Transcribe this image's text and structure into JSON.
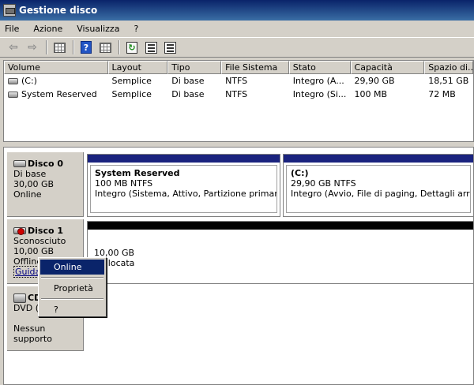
{
  "window": {
    "title": "Gestione disco"
  },
  "menu": [
    "File",
    "Azione",
    "Visualizza",
    "?"
  ],
  "toolbar": {
    "icons": [
      "back-arrow-icon",
      "forward-arrow-icon",
      "console-tree-icon",
      "help-icon",
      "grid-view-icon",
      "refresh-icon",
      "properties-icon",
      "settings-icon"
    ],
    "help_glyph": "?"
  },
  "volume_list": {
    "columns": [
      "Volume",
      "Layout",
      "Tipo",
      "File Sistema",
      "Stato",
      "Capacità",
      "Spazio di..."
    ],
    "rows": [
      [
        "(C:)",
        "Semplice",
        "Di base",
        "NTFS",
        "Integro (A...",
        "29,90 GB",
        "18,51 GB"
      ],
      [
        "System Reserved",
        "Semplice",
        "Di base",
        "NTFS",
        "Integro (Si...",
        "100 MB",
        "72 MB"
      ]
    ]
  },
  "disks": [
    {
      "name": "Disco 0",
      "type": "Di base",
      "size": "30,00 GB",
      "status": "Online",
      "partitions": [
        {
          "name": "System Reserved",
          "fs": "100 MB NTFS",
          "status": "Integro (Sistema, Attivo, Partizione primaria)",
          "bar_color": "#1a237e"
        },
        {
          "name": "(C:)",
          "fs": "29,90 GB NTFS",
          "status": "Integro (Avvio, File di paging, Dettagli arresto anomalo, Partizione primaria)",
          "bar_color": "#1a237e"
        }
      ]
    },
    {
      "name": "Disco 1",
      "type": "Sconosciuto",
      "size": "10,00 GB",
      "status": "Offline",
      "link": "Guida",
      "partitions": [
        {
          "size": "10,00 GB",
          "label": "allocata",
          "bar_color": "#000000"
        }
      ]
    },
    {
      "name": "CD",
      "type": "DVD (D",
      "status": "Nessun supporto"
    }
  ],
  "context_menu": {
    "items": [
      "Online",
      "Proprietà",
      "?"
    ],
    "highlighted": "Online"
  }
}
